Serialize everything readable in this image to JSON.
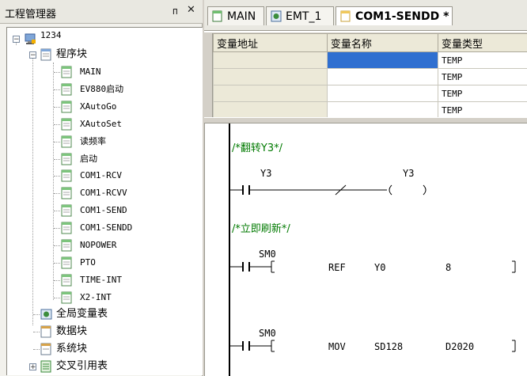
{
  "left_panel": {
    "title": "工程管理器",
    "pin_glyph": "ᴨ",
    "close_glyph": "✕",
    "tree": {
      "project": "1234",
      "program_block": "程序块",
      "programs": [
        "MAIN",
        "EV880启动",
        "XAutoGo",
        "XAutoSet",
        "读频率",
        "启动",
        "COM1-RCV",
        "COM1-RCVV",
        "COM1-SEND",
        "COM1-SENDD",
        "NOPOWER",
        "PTO",
        "TIME-INT",
        "X2-INT"
      ],
      "global_vars": "全局变量表",
      "data_block": "数据块",
      "system_block": "系统块",
      "cross_ref": "交叉引用表"
    }
  },
  "tabs": [
    {
      "label": "MAIN",
      "icon": "program-icon"
    },
    {
      "label": "EMT_1",
      "icon": "module-icon"
    },
    {
      "label": "COM1-SENDD *",
      "icon": "program-icon",
      "active": true
    }
  ],
  "var_table": {
    "headers": [
      "变量地址",
      "变量名称",
      "变量类型"
    ],
    "rows": [
      {
        "addr": "",
        "name": "",
        "type": "TEMP"
      },
      {
        "addr": "",
        "name": "",
        "type": "TEMP"
      },
      {
        "addr": "",
        "name": "",
        "type": "TEMP"
      },
      {
        "addr": "",
        "name": "",
        "type": "TEMP"
      }
    ]
  },
  "ladder": {
    "rungs": [
      {
        "comment": "/*翻转Y3*/",
        "contact": "Y3",
        "coil": "Y3"
      },
      {
        "comment": "/*立即刷新*/",
        "contact": "SM0",
        "instr": "REF",
        "op1": "Y0",
        "op2": "8"
      },
      {
        "contact": "SM0",
        "instr": "MOV",
        "op1": "SD128",
        "op2": "D2020"
      }
    ]
  },
  "colors": {
    "accent": "#2f6fd0",
    "comment": "#007a00"
  }
}
